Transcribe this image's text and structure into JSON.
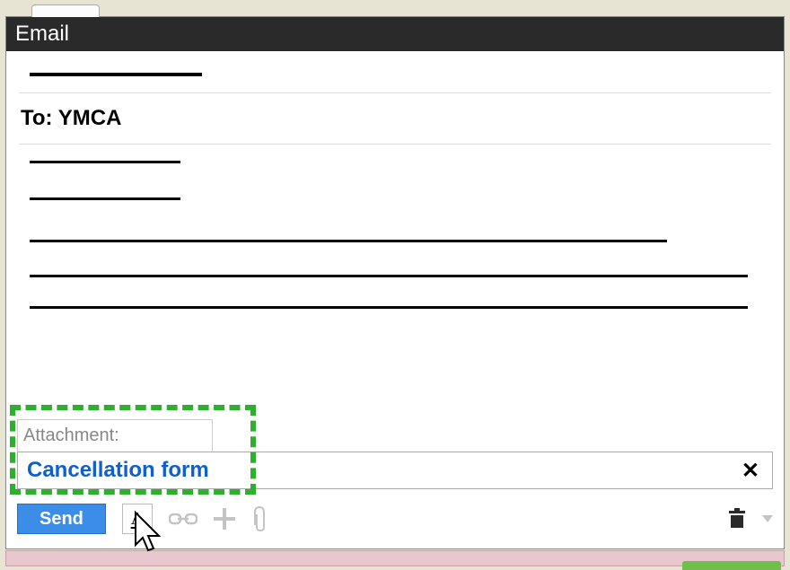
{
  "window": {
    "title": "Email"
  },
  "to": {
    "prefix": "To:",
    "recipient": "YMCA"
  },
  "attachment": {
    "label": "Attachment:",
    "filename": "Cancellation form"
  },
  "toolbar": {
    "send_label": "Send",
    "format_label": "A"
  }
}
